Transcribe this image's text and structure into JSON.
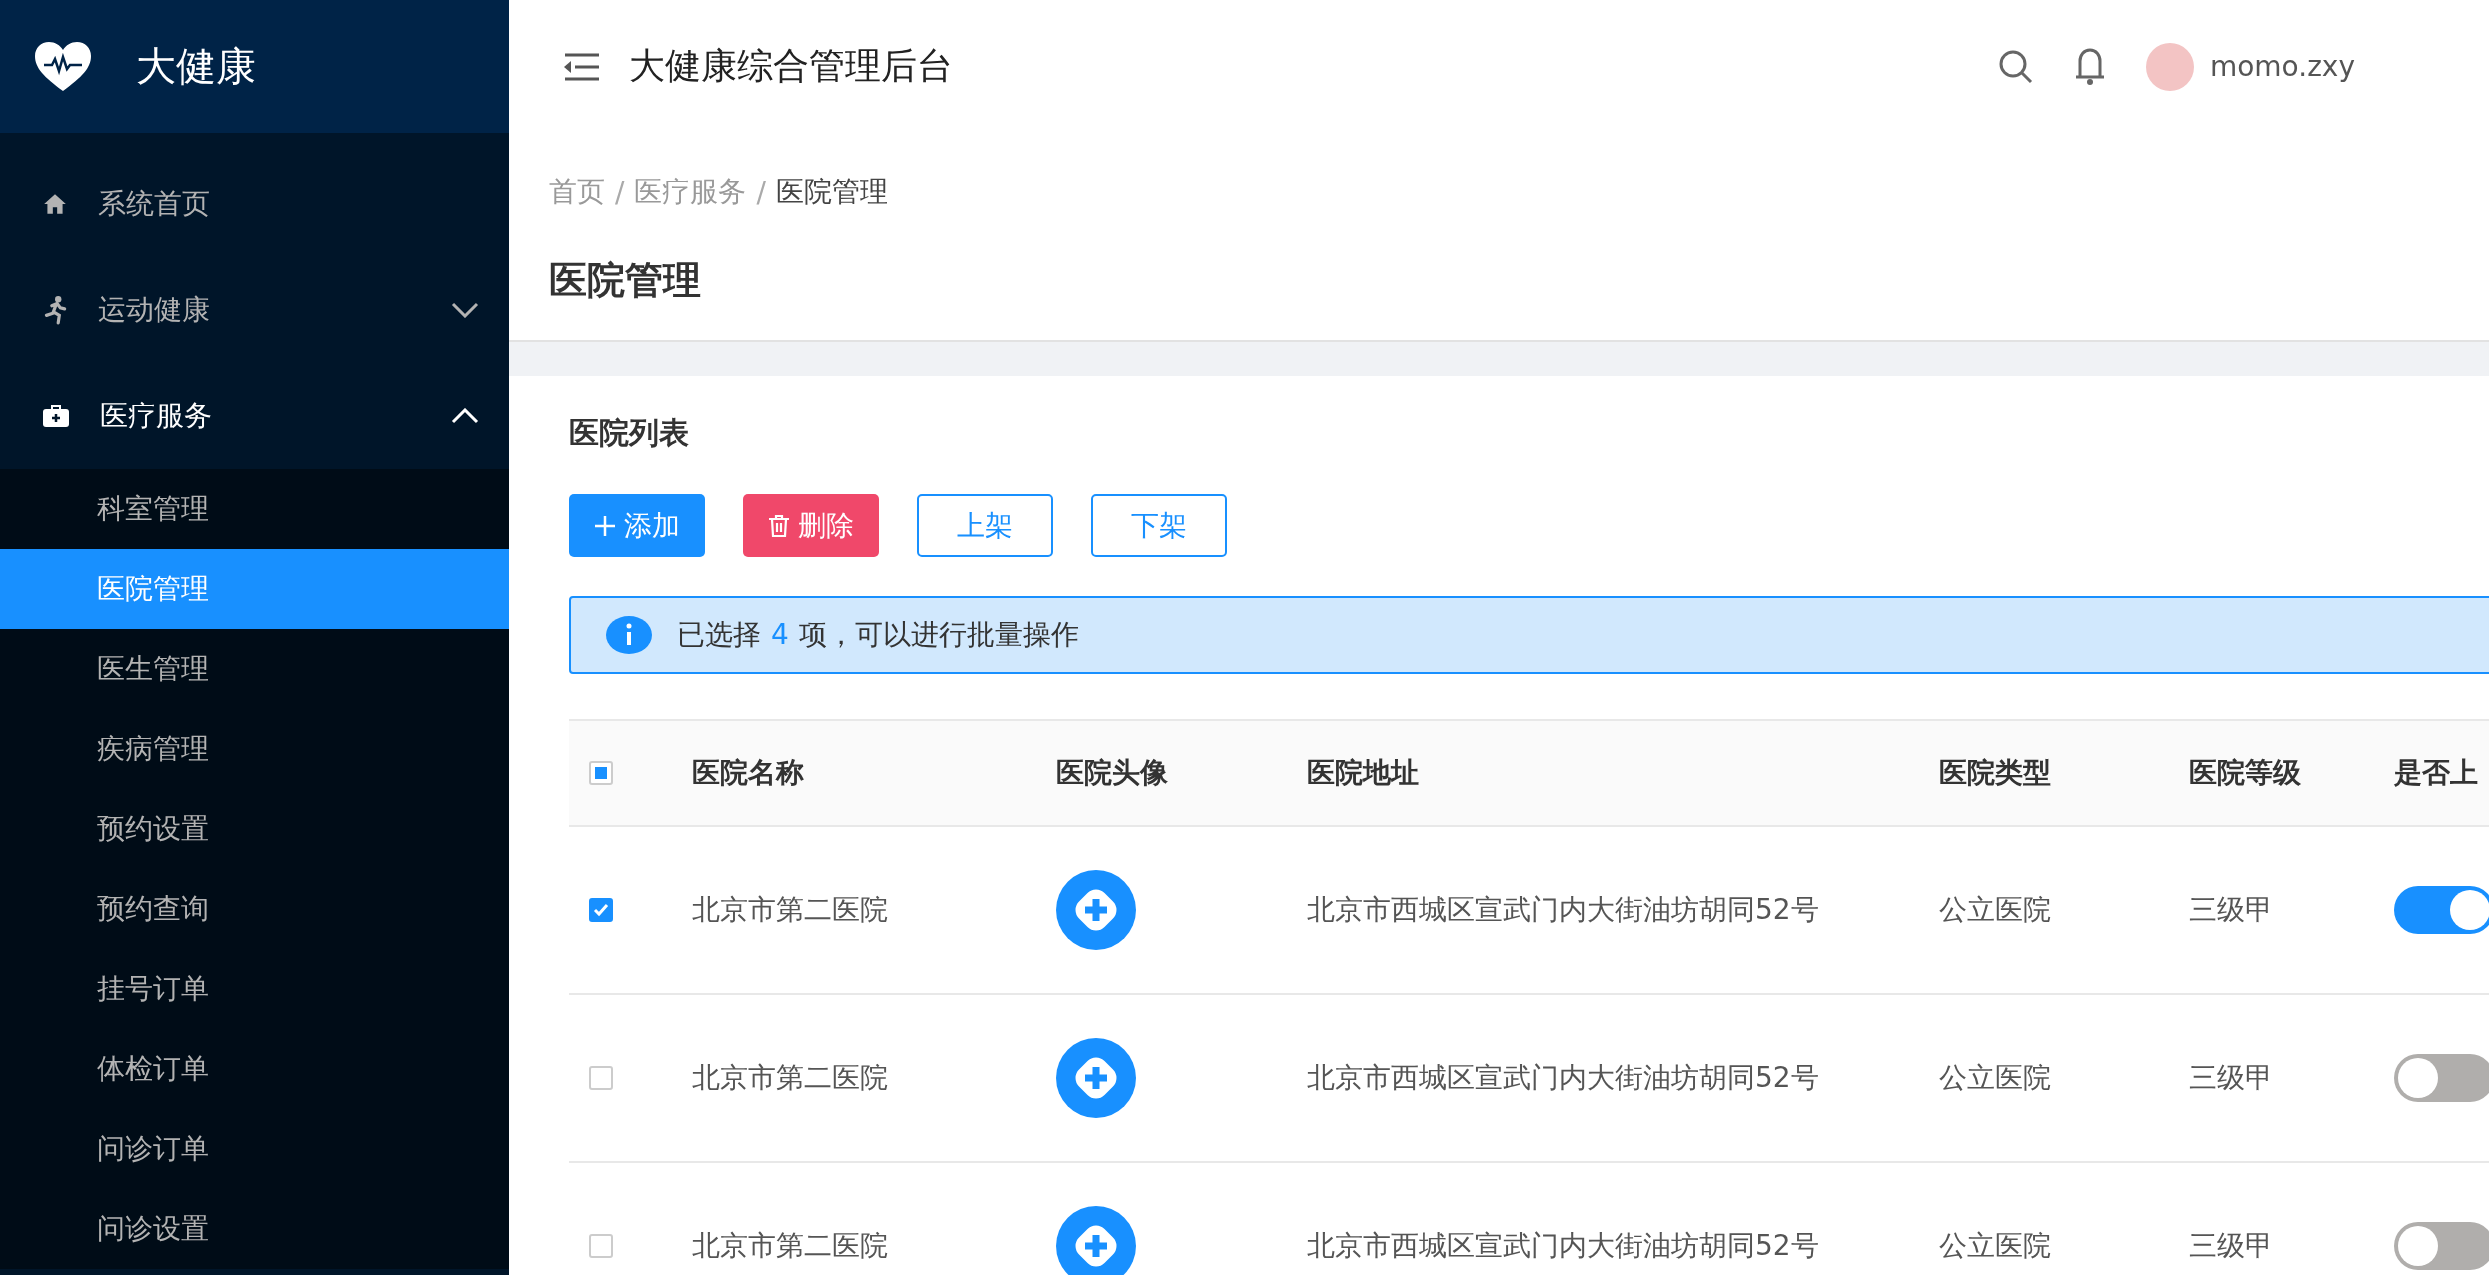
{
  "sidebar": {
    "brand": "大健康",
    "menu": [
      {
        "label": "系统首页",
        "kind": "home",
        "selected": false
      },
      {
        "label": "运动健康",
        "kind": "run",
        "selected": false,
        "expanded": false
      },
      {
        "label": "医疗服务",
        "kind": "medkit",
        "selected": true,
        "expanded": true,
        "children": [
          {
            "label": "科室管理",
            "selected": false
          },
          {
            "label": "医院管理",
            "selected": true
          },
          {
            "label": "医生管理",
            "selected": false
          },
          {
            "label": "疾病管理",
            "selected": false
          },
          {
            "label": "预约设置",
            "selected": false
          },
          {
            "label": "预约查询",
            "selected": false
          },
          {
            "label": "挂号订单",
            "selected": false
          },
          {
            "label": "体检订单",
            "selected": false
          },
          {
            "label": "问诊订单",
            "selected": false
          },
          {
            "label": "问诊设置",
            "selected": false
          }
        ]
      }
    ]
  },
  "header": {
    "title": "大健康综合管理后台",
    "user": "momo.zxy"
  },
  "breadcrumb": [
    {
      "label": "首页",
      "current": false
    },
    {
      "separator": "/",
      "label": "医疗服务",
      "current": false
    },
    {
      "separator": "/",
      "label": "医院管理",
      "current": true
    }
  ],
  "page_title": "医院管理",
  "card": {
    "title": "医院列表",
    "buttons": [
      {
        "label": "添加",
        "kind": "primary"
      },
      {
        "label": "删除",
        "kind": "danger"
      },
      {
        "label": "上架",
        "kind": "outline"
      },
      {
        "label": "下架",
        "kind": "outline"
      }
    ],
    "alert": {
      "prefix": "已选择",
      "count": "4",
      "suffix": "项，可以进行批量操作"
    },
    "table": {
      "select_all": {
        "indeterminate": true
      },
      "columns": [
        "医院名称",
        "医院头像",
        "医院地址",
        "医院类型",
        "医院等级",
        "是否上"
      ],
      "rows": [
        {
          "checked": true,
          "name": "北京市第二医院",
          "address": "北京市西城区宣武门内大街油坊胡同52号",
          "type": "公立医院",
          "level": "三级甲",
          "on": true
        },
        {
          "checked": false,
          "name": "北京市第二医院",
          "address": "北京市西城区宣武门内大街油坊胡同52号",
          "type": "公立医院",
          "level": "三级甲",
          "on": false
        },
        {
          "checked": false,
          "name": "北京市第二医院",
          "address": "北京市西城区宣武门内大街油坊胡同52号",
          "type": "公立医院",
          "level": "三级甲",
          "on": false
        }
      ]
    }
  }
}
